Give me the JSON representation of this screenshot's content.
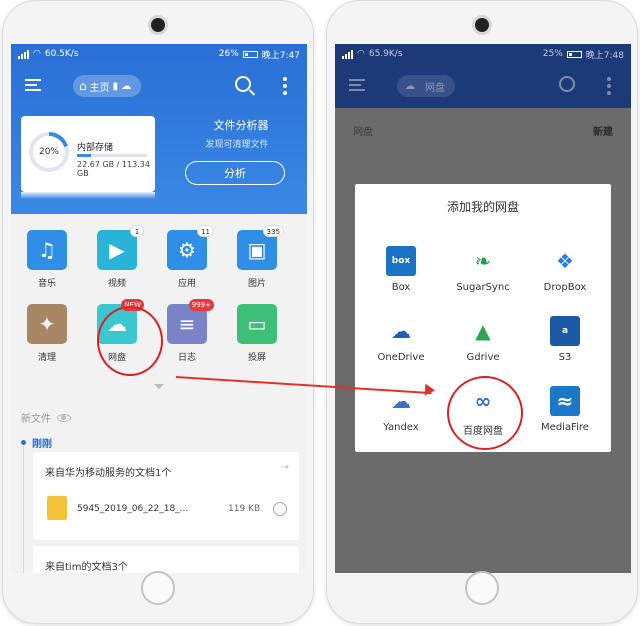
{
  "left_phone": {
    "status": {
      "speed": "60.5K/s",
      "battery": "26%",
      "time": "晚上7:47"
    },
    "topbar": {
      "home_label": "主页"
    },
    "storage": {
      "percent": "20%",
      "name": "内部存储",
      "size": "22.67 GB / 113.34 GB",
      "used_fraction": 0.2
    },
    "analyzer": {
      "title": "文件分析器",
      "subtitle": "发现可清理文件",
      "button": "分析"
    },
    "grid": [
      {
        "label": "音乐",
        "icon": "music-icon",
        "color": "#2f8fe6",
        "badge": ""
      },
      {
        "label": "视频",
        "icon": "video-icon",
        "color": "#29b3d6",
        "badge": "1"
      },
      {
        "label": "应用",
        "icon": "android-icon",
        "color": "#2f8fe6",
        "badge": "11"
      },
      {
        "label": "图片",
        "icon": "image-icon",
        "color": "#2f8fe6",
        "badge": "335"
      },
      {
        "label": "清理",
        "icon": "broom-icon",
        "color": "#a88764",
        "badge": ""
      },
      {
        "label": "网盘",
        "icon": "cloud-icon",
        "color": "#3ac7cf",
        "badge": "NEW"
      },
      {
        "label": "日志",
        "icon": "log-icon",
        "color": "#7a82c8",
        "badge": "999+"
      },
      {
        "label": "投屏",
        "icon": "cast-icon",
        "color": "#3dbf7a",
        "badge": ""
      }
    ],
    "new_files_label": "新文件",
    "just_now_label": "刚刚",
    "card1": {
      "title": "来自华为移动服务的文档1个",
      "file_name": "5945_2019_06_22_18_...",
      "file_size": "119 KB"
    },
    "card2": {
      "title": "来自tim的文档3个"
    }
  },
  "right_phone": {
    "status": {
      "speed": "65.9K/s",
      "battery": "25%",
      "time": "晚上7:48"
    },
    "topbar": {
      "pill_label": "网盘"
    },
    "list_header": {
      "left": "网盘",
      "right": "新建"
    },
    "dialog": {
      "title": "添加我的网盘",
      "providers": [
        {
          "name": "Box",
          "icon": "box-logo-icon",
          "color": "#1a74c6",
          "mark": "box"
        },
        {
          "name": "SugarSync",
          "icon": "sugarsync-logo-icon",
          "color": "#ffffff",
          "mark": ""
        },
        {
          "name": "DropBox",
          "icon": "dropbox-logo-icon",
          "color": "#ffffff",
          "mark": ""
        },
        {
          "name": "OneDrive",
          "icon": "onedrive-logo-icon",
          "color": "#ffffff",
          "mark": ""
        },
        {
          "name": "Gdrive",
          "icon": "gdrive-logo-icon",
          "color": "#ffffff",
          "mark": ""
        },
        {
          "name": "S3",
          "icon": "s3-logo-icon",
          "color": "#1c5aa6",
          "mark": "a"
        },
        {
          "name": "Yandex",
          "icon": "yandex-logo-icon",
          "color": "#ffffff",
          "mark": ""
        },
        {
          "name": "百度网盘",
          "icon": "baidu-netdisk-logo-icon",
          "color": "#ffffff",
          "mark": ""
        },
        {
          "name": "MediaFire",
          "icon": "mediafire-logo-icon",
          "color": "#1b78c9",
          "mark": ""
        }
      ]
    }
  },
  "colors": {
    "primary_blue": "#2a6fd6",
    "annotation_red": "#e0322b"
  }
}
